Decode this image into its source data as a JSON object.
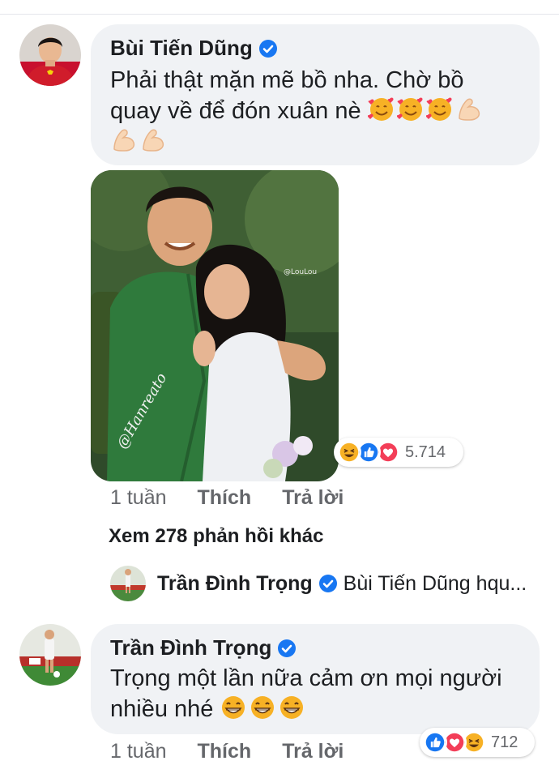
{
  "comment1": {
    "author": "Bùi Tiến Dũng",
    "text": "Phải thật mặn mẽ bồ nha. Chờ bồ quay về để đón xuân nè",
    "emojis": [
      "smiling-hearts-emoji",
      "smiling-hearts-emoji",
      "smiling-hearts-emoji",
      "flexed-biceps-emoji",
      "flexed-biceps-emoji",
      "flexed-biceps-emoji"
    ],
    "photo_watermark": "@LouLou",
    "photo_signature": "@Hanreato",
    "reactions": {
      "icons": [
        "haha-icon",
        "like-icon",
        "love-icon"
      ],
      "count": "5.714"
    },
    "actions": {
      "time": "1 tuần",
      "like": "Thích",
      "reply": "Trả lời"
    },
    "more_replies": "Xem 278 phản hồi khác",
    "reply_preview": {
      "author": "Trần Đình Trọng",
      "text": "Bùi Tiến Dũng hqu..."
    }
  },
  "comment2": {
    "author": "Trần Đình Trọng",
    "text_line1": "Trọng một lần nữa cảm ơn mọi người",
    "text_line2": "nhiều nhé",
    "emojis": [
      "grinning-emoji",
      "grinning-emoji",
      "grinning-emoji"
    ],
    "reactions": {
      "icons": [
        "like-icon",
        "love-icon",
        "haha-icon"
      ],
      "count": "712"
    },
    "actions": {
      "time": "1 tuần",
      "like": "Thích",
      "reply": "Trả lời"
    }
  },
  "colors": {
    "bubble": "#f0f2f5",
    "verified": "#1877f2",
    "muted": "#65676b",
    "like": "#1877f2",
    "love": "#f33e58",
    "haha": "#f7b125"
  }
}
